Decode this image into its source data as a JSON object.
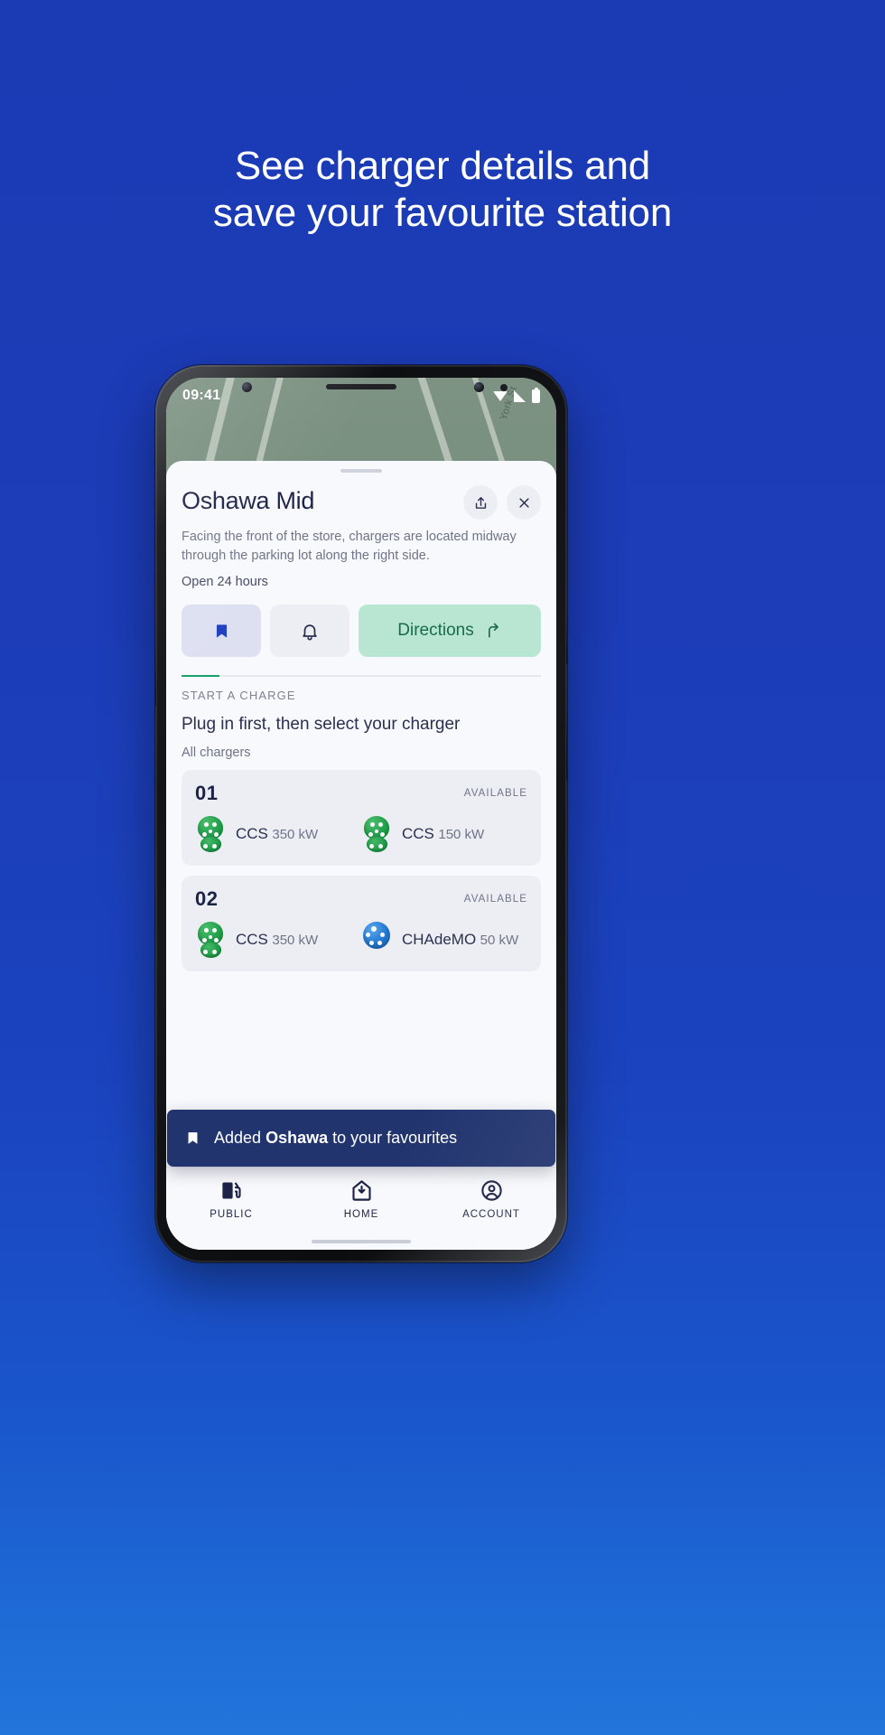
{
  "headline": {
    "line1": "See charger details and",
    "line2": "save your favourite station"
  },
  "colors": {
    "background_blue": "#1b3bb5",
    "accent_green": "#17a06a",
    "bookmark_blue": "#1f3fbf",
    "toast_navy": "#21346e",
    "directions_bg": "#b9e5d3",
    "directions_text": "#1a6b4d",
    "ccs_green": "#22a04c",
    "chademo_blue": "#2277cf"
  },
  "phone": {
    "statusbar": {
      "time": "09:41",
      "icons": [
        "wifi-icon",
        "signal-icon",
        "battery-icon"
      ]
    },
    "map": {
      "street_label": "York St"
    }
  },
  "sheet": {
    "station_title": "Oshawa Mid",
    "share_icon": "share-icon",
    "close_icon": "close-icon",
    "description": "Facing the front of the store, chargers are located midway through the parking lot along the right side.",
    "hours": "Open 24 hours",
    "actions": {
      "bookmark_icon": "bookmark-icon",
      "notify_icon": "bell-icon",
      "directions_label": "Directions",
      "directions_icon": "directions-arrow-icon"
    },
    "section": {
      "eyebrow": "START A CHARGE",
      "title": "Plug in first, then select your charger",
      "subtitle": "All chargers"
    },
    "chargers": [
      {
        "number": "01",
        "status": "AVAILABLE",
        "connectors": [
          {
            "type": "CCS",
            "power": "350 kW",
            "icon": "ccs-connector-icon"
          },
          {
            "type": "CCS",
            "power": "150 kW",
            "icon": "ccs-connector-icon"
          }
        ]
      },
      {
        "number": "02",
        "status": "AVAILABLE",
        "connectors": [
          {
            "type": "CCS",
            "power": "350 kW",
            "icon": "ccs-connector-icon"
          },
          {
            "type": "CHAdeMO",
            "power": "50 kW",
            "icon": "chademo-connector-icon"
          }
        ]
      }
    ],
    "toast": {
      "icon": "bookmark-icon",
      "prefix": "Added ",
      "station": "Oshawa",
      "suffix": " to your favourites"
    }
  },
  "bottom_nav": [
    {
      "label": "PUBLIC",
      "icon": "charger-pump-icon"
    },
    {
      "label": "HOME",
      "icon": "home-icon"
    },
    {
      "label": "ACCOUNT",
      "icon": "account-icon"
    }
  ]
}
